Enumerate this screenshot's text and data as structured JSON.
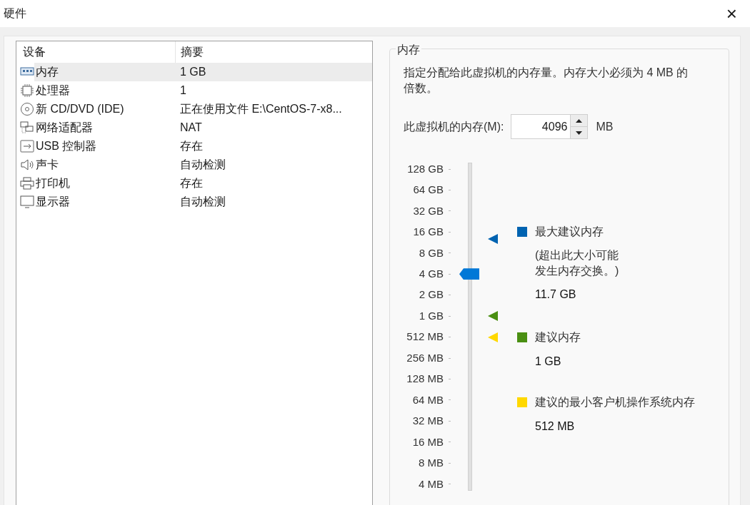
{
  "window": {
    "title": "硬件",
    "close": "×"
  },
  "devices": {
    "columns": [
      "设备",
      "摘要"
    ],
    "rows": [
      {
        "name": "内存",
        "summary": "1 GB",
        "selected": true
      },
      {
        "name": "处理器",
        "summary": "1",
        "selected": false
      },
      {
        "name": "新 CD/DVD (IDE)",
        "summary": "正在使用文件 E:\\CentOS-7-x8...",
        "selected": false
      },
      {
        "name": "网络适配器",
        "summary": "NAT",
        "selected": false
      },
      {
        "name": "USB 控制器",
        "summary": "存在",
        "selected": false
      },
      {
        "name": "声卡",
        "summary": "自动检测",
        "selected": false
      },
      {
        "name": "打印机",
        "summary": "存在",
        "selected": false
      },
      {
        "name": "显示器",
        "summary": "自动检测",
        "selected": false
      }
    ]
  },
  "memory": {
    "title": "内存",
    "description": "指定分配给此虚拟机的内存量。内存大小必须为 4 MB 的倍数。",
    "field_label": "此虚拟机的内存(M):",
    "value": "4096",
    "unit": "MB",
    "slider": {
      "level": 0.667,
      "ticks": [
        "128 GB",
        "64 GB",
        "32 GB",
        "16 GB",
        "8 GB",
        "4 GB",
        "2 GB",
        "1 GB",
        "512 MB",
        "256 MB",
        "128 MB",
        "64 MB",
        "32 MB",
        "16 MB",
        "8 MB",
        "4 MB"
      ]
    },
    "legend": [
      {
        "color": "#0063b1",
        "label": "最大建议内存",
        "note": [
          "(超出此大小可能",
          "发生内存交换。)"
        ],
        "value": "11.7 GB"
      },
      {
        "color": "#4a8f12",
        "label": "建议内存",
        "value": "1 GB"
      },
      {
        "color": "#ffd800",
        "label": "建议的最小客户机操作系统内存",
        "value": "512 MB"
      }
    ]
  }
}
